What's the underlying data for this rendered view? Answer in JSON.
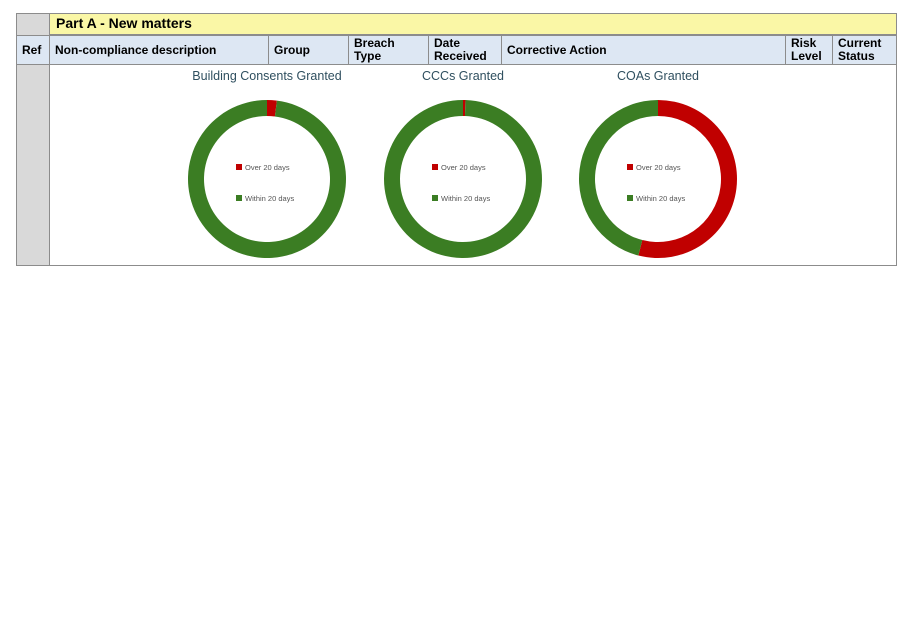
{
  "section_title": "Part A - New matters",
  "headers": {
    "ref": "Ref",
    "description": "Non-compliance description",
    "group": "Group",
    "breach_1": "Breach",
    "breach_2": "Type",
    "date_1": "Date",
    "date_2": "Received",
    "corrective": "Corrective Action",
    "risk_1": "Risk",
    "risk_2": "Level",
    "status_1": "Current",
    "status_2": "Status"
  },
  "colors": {
    "over": "#c00000",
    "within": "#3b7d23"
  },
  "chart_data": [
    {
      "type": "pie",
      "donut": true,
      "title": "Building Consents Granted",
      "labels": [
        "Over 20 days",
        "Within 20 days"
      ],
      "values": [
        2,
        98
      ],
      "legend": "center"
    },
    {
      "type": "pie",
      "donut": true,
      "title": "CCCs Granted",
      "labels": [
        "Over 20 days",
        "Within 20 days"
      ],
      "values": [
        0.5,
        99.5
      ],
      "legend": "center"
    },
    {
      "type": "pie",
      "donut": true,
      "title": "COAs Granted",
      "labels": [
        "Over 20 days",
        "Within 20 days"
      ],
      "values": [
        54,
        46
      ],
      "legend": "center"
    }
  ]
}
